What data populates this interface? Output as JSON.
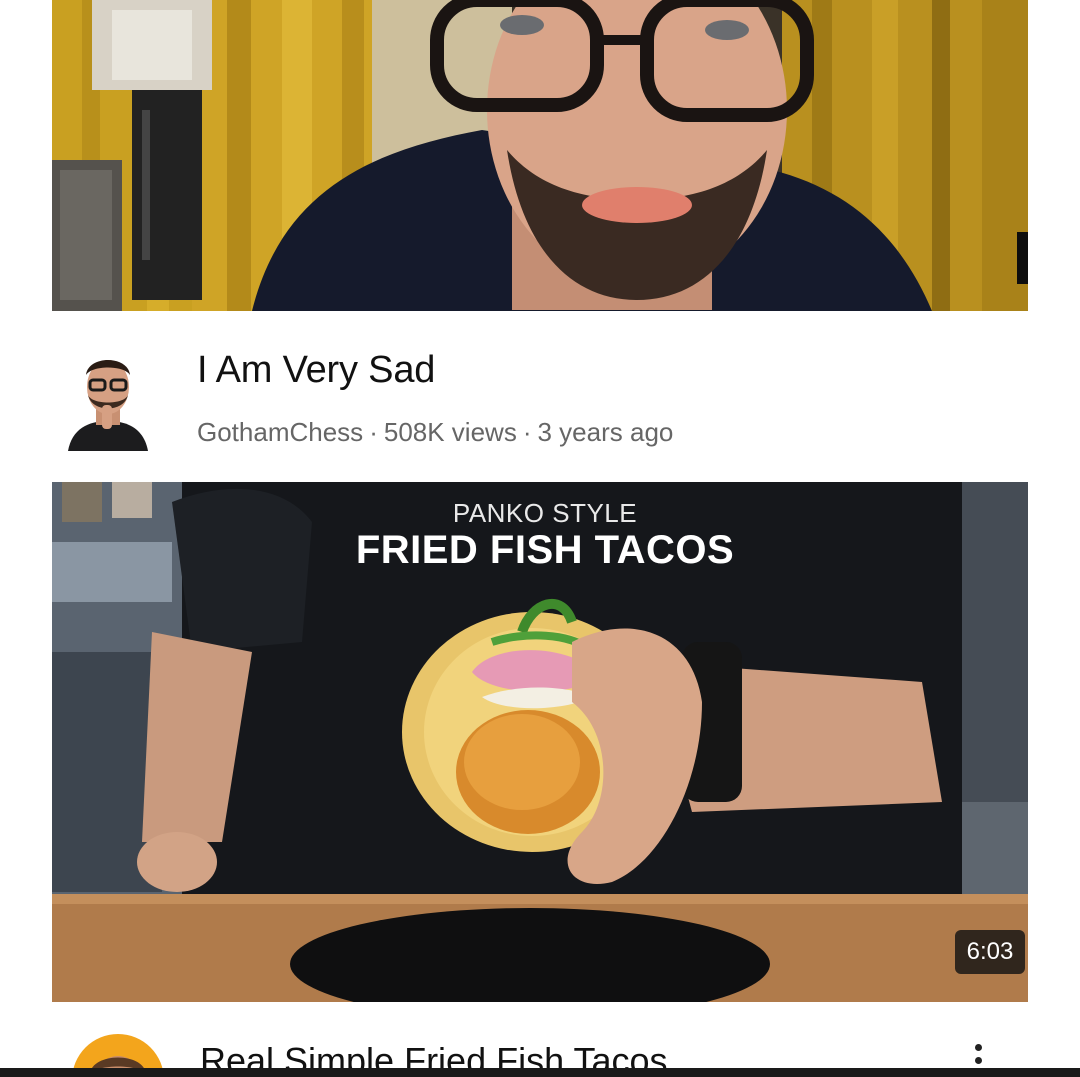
{
  "feed": {
    "videos": [
      {
        "title": "I Am Very Sad",
        "channel": "GothamChess",
        "views": "508K views",
        "age": "3 years ago",
        "separator": "·"
      },
      {
        "overlay_small": "PANKO STYLE",
        "overlay_big": "FRIED FISH TACOS",
        "duration": "6:03",
        "title": "Real Simple Fried Fish Tacos",
        "menu_icon": "more-vert-icon"
      }
    ]
  },
  "colors": {
    "background": "#ffffff",
    "title_text": "#111111",
    "meta_text": "#666666",
    "duration_bg": "#141414",
    "channel_avatar2_bg": "#f3a51c"
  }
}
